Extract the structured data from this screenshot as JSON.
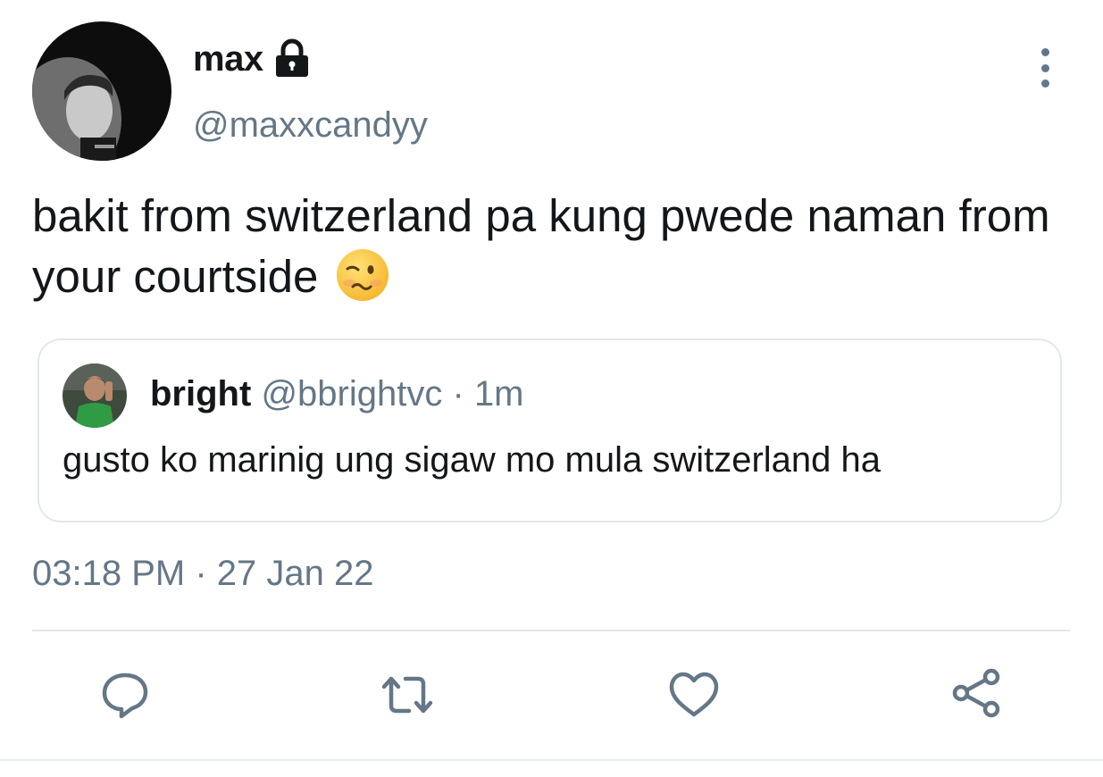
{
  "tweet": {
    "author": {
      "display_name": "max",
      "handle": "@maxxcandyy",
      "protected_icon": "lock-icon"
    },
    "text": "bakit from switzerland pa kung pwede naman from your courtside",
    "emoji": "woozy-face-icon",
    "timestamp": "03:18 PM · 27 Jan 22"
  },
  "quoted_tweet": {
    "display_name": "bright",
    "handle": "@bbrightvc",
    "separator": "·",
    "time": "1m",
    "text": "gusto ko marinig ung sigaw mo mula switzerland ha"
  },
  "actions": [
    {
      "name": "reply",
      "icon": "reply-bubble-icon"
    },
    {
      "name": "retweet",
      "icon": "retweet-icon"
    },
    {
      "name": "like",
      "icon": "heart-icon"
    },
    {
      "name": "share",
      "icon": "share-icon"
    }
  ],
  "colors": {
    "text_primary": "#14171a",
    "text_secondary": "#657786",
    "border": "#e1e8ed"
  }
}
